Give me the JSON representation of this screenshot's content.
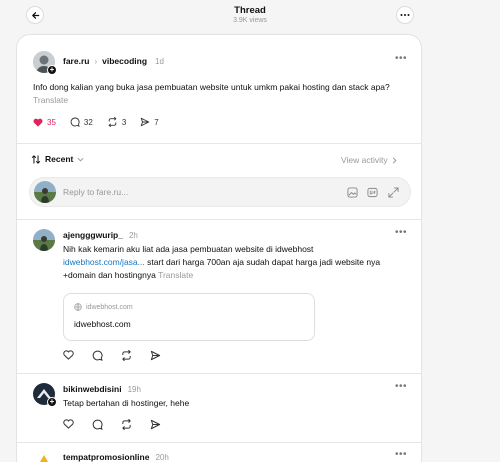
{
  "header": {
    "title": "Thread",
    "views": "3.9K views"
  },
  "post": {
    "username": "fare.ru",
    "separator": "›",
    "community": "vibecoding",
    "time": "1d",
    "text": "Info dong kalian yang buka jasa pembuatan website untuk umkm pakai hosting dan stack apa?",
    "translate": "Translate",
    "likes": "35",
    "comments": "32",
    "reposts": "3",
    "shares": "7"
  },
  "sort": {
    "label": "Recent",
    "view_activity": "View activity"
  },
  "reply_input": {
    "placeholder": "Reply to fare.ru..."
  },
  "replies": [
    {
      "username": "ajengggwurip_",
      "time": "2h",
      "text_before": "Nih kak kemarin aku liat ada jasa pembuatan website di idwebhost",
      "link": "idwebhost.com/jasa...",
      "text_after": " start dari harga 700an aja sudah dapat harga jadi website nya +domain dan hostingnya",
      "translate": "Translate",
      "link_card_domain": "idwebhost.com",
      "link_card_title": "idwebhost.com"
    },
    {
      "username": "bikinwebdisini",
      "time": "19h",
      "text": "Tetap bertahan di hostinger, hehe"
    },
    {
      "username": "tempatpromosionline",
      "time": "20h"
    }
  ],
  "colors": {
    "heart": "#e0245e",
    "link": "#1877c2"
  }
}
